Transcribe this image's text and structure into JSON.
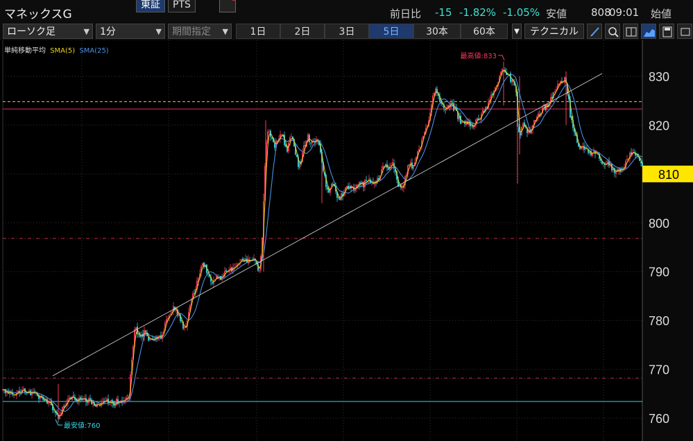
{
  "header": {
    "title": "マネックスG",
    "exchange_active": "東証",
    "exchange_other": "PTS",
    "prev_label": "前日比",
    "change": "-15",
    "change_pct": "-1.82%",
    "change_pct2": "-1.05%",
    "low_label": "安値",
    "low_value": "808",
    "time": "09:01",
    "open_label": "始値"
  },
  "toolbar": {
    "chart_type": "ローソク足",
    "interval": "1分",
    "period": "期間指定",
    "tabs": [
      "1日",
      "2日",
      "3日",
      "5日",
      "30本",
      "60本"
    ],
    "active_tab": "5日",
    "technical_label": "テクニカル"
  },
  "legend": {
    "title": "単純移動平均",
    "sma5": "SMA(5)",
    "sma25": "SMA(25)"
  },
  "colors": {
    "sma5": "#e8d21a",
    "sma25": "#4a90e2",
    "up": "#ff3a5a",
    "down": "#38d8e8",
    "price_box": "#ffe600"
  },
  "chart_data": {
    "type": "candlestick",
    "ylim": [
      757,
      840
    ],
    "y_ticks": [
      760,
      770,
      780,
      790,
      800,
      810,
      820,
      830
    ],
    "current_price": "810",
    "high_label": "最高値:833",
    "low_label": "最安値:760",
    "series": [
      {
        "name": "SMA(5)"
      },
      {
        "name": "SMA(25)"
      }
    ],
    "close_path": [
      [
        0,
        765.5
      ],
      [
        8,
        765.5
      ],
      [
        18,
        765.2
      ],
      [
        30,
        765.8
      ],
      [
        40,
        765.0
      ],
      [
        50,
        764.5
      ],
      [
        60,
        764.0
      ],
      [
        68,
        763.0
      ],
      [
        74,
        761.5
      ],
      [
        80,
        760.5
      ],
      [
        86,
        762.0
      ],
      [
        92,
        763.5
      ],
      [
        100,
        764.2
      ],
      [
        108,
        763.8
      ],
      [
        116,
        764.0
      ],
      [
        124,
        763.5
      ],
      [
        132,
        762.8
      ],
      [
        140,
        763.0
      ],
      [
        150,
        763.5
      ],
      [
        160,
        763.2
      ],
      [
        170,
        763.6
      ],
      [
        178,
        763.8
      ],
      [
        182,
        765.0
      ],
      [
        185,
        770.0
      ],
      [
        188,
        775.0
      ],
      [
        190,
        778.5
      ],
      [
        195,
        777.0
      ],
      [
        200,
        776.5
      ],
      [
        205,
        777.5
      ],
      [
        210,
        776.5
      ],
      [
        215,
        776.0
      ],
      [
        220,
        776.0
      ],
      [
        225,
        776.5
      ],
      [
        230,
        777.0
      ],
      [
        235,
        779.5
      ],
      [
        240,
        781.5
      ],
      [
        245,
        782.5
      ],
      [
        250,
        782.0
      ],
      [
        255,
        780.5
      ],
      [
        260,
        778.5
      ],
      [
        265,
        779.5
      ],
      [
        270,
        782.5
      ],
      [
        275,
        785.5
      ],
      [
        280,
        788.0
      ],
      [
        285,
        790.5
      ],
      [
        290,
        791.5
      ],
      [
        295,
        789.5
      ],
      [
        300,
        788.0
      ],
      [
        305,
        788.5
      ],
      [
        310,
        789.0
      ],
      [
        315,
        788.5
      ],
      [
        320,
        789.5
      ],
      [
        325,
        790.5
      ],
      [
        330,
        790.5
      ],
      [
        335,
        791.0
      ],
      [
        340,
        791.5
      ],
      [
        345,
        792.0
      ],
      [
        350,
        792.0
      ],
      [
        355,
        792.5
      ],
      [
        360,
        792.5
      ],
      [
        365,
        791.5
      ],
      [
        370,
        790.5
      ],
      [
        373,
        793.5
      ],
      [
        376,
        805.0
      ],
      [
        379,
        815.0
      ],
      [
        382,
        819.0
      ],
      [
        385,
        818.5
      ],
      [
        388,
        817.5
      ],
      [
        392,
        816.0
      ],
      [
        396,
        817.0
      ],
      [
        400,
        818.5
      ],
      [
        405,
        817.0
      ],
      [
        410,
        814.5
      ],
      [
        415,
        817.5
      ],
      [
        420,
        816.0
      ],
      [
        425,
        812.0
      ],
      [
        430,
        812.5
      ],
      [
        435,
        816.0
      ],
      [
        440,
        817.5
      ],
      [
        445,
        816.0
      ],
      [
        450,
        817.0
      ],
      [
        455,
        817.5
      ],
      [
        460,
        813.0
      ],
      [
        465,
        808.0
      ],
      [
        470,
        806.0
      ],
      [
        475,
        808.5
      ],
      [
        480,
        806.0
      ],
      [
        485,
        804.5
      ],
      [
        490,
        806.0
      ],
      [
        495,
        807.0
      ],
      [
        500,
        807.5
      ],
      [
        505,
        807.0
      ],
      [
        510,
        807.5
      ],
      [
        515,
        808.5
      ],
      [
        520,
        807.5
      ],
      [
        525,
        809.0
      ],
      [
        530,
        808.5
      ],
      [
        535,
        808.0
      ],
      [
        540,
        808.5
      ],
      [
        545,
        810.5
      ],
      [
        550,
        812.0
      ],
      [
        555,
        811.0
      ],
      [
        560,
        812.5
      ],
      [
        565,
        810.5
      ],
      [
        570,
        808.0
      ],
      [
        575,
        807.5
      ],
      [
        580,
        809.0
      ],
      [
        585,
        812.0
      ],
      [
        590,
        811.5
      ],
      [
        595,
        813.0
      ],
      [
        600,
        815.0
      ],
      [
        605,
        817.0
      ],
      [
        610,
        819.0
      ],
      [
        615,
        821.5
      ],
      [
        620,
        825.5
      ],
      [
        625,
        827.5
      ],
      [
        628,
        826.0
      ],
      [
        632,
        824.0
      ],
      [
        637,
        823.5
      ],
      [
        642,
        823.5
      ],
      [
        647,
        824.5
      ],
      [
        652,
        823.0
      ],
      [
        657,
        821.5
      ],
      [
        662,
        820.5
      ],
      [
        667,
        821.0
      ],
      [
        672,
        820.5
      ],
      [
        677,
        819.5
      ],
      [
        682,
        820.5
      ],
      [
        687,
        821.5
      ],
      [
        692,
        822.5
      ],
      [
        697,
        823.5
      ],
      [
        702,
        825.0
      ],
      [
        707,
        826.5
      ],
      [
        712,
        828.5
      ],
      [
        717,
        830.5
      ],
      [
        722,
        831.5
      ],
      [
        727,
        830.5
      ],
      [
        732,
        829.5
      ],
      [
        737,
        829.0
      ],
      [
        740,
        826.5
      ],
      [
        742,
        820.0
      ],
      [
        745,
        818.0
      ],
      [
        748,
        819.5
      ],
      [
        752,
        820.0
      ],
      [
        756,
        818.5
      ],
      [
        760,
        818.5
      ],
      [
        765,
        820.5
      ],
      [
        770,
        821.5
      ],
      [
        775,
        822.5
      ],
      [
        780,
        823.5
      ],
      [
        785,
        824.0
      ],
      [
        790,
        825.5
      ],
      [
        795,
        826.5
      ],
      [
        800,
        828.0
      ],
      [
        805,
        828.5
      ],
      [
        810,
        829.5
      ],
      [
        815,
        826.0
      ],
      [
        818,
        822.0
      ],
      [
        822,
        820.0
      ],
      [
        826,
        818.0
      ],
      [
        830,
        816.0
      ],
      [
        835,
        815.5
      ],
      [
        840,
        815.0
      ],
      [
        845,
        814.5
      ],
      [
        850,
        814.0
      ],
      [
        855,
        814.5
      ],
      [
        860,
        813.5
      ],
      [
        865,
        812.5
      ],
      [
        870,
        812.0
      ],
      [
        875,
        812.0
      ],
      [
        880,
        810.5
      ],
      [
        885,
        810.0
      ],
      [
        890,
        811.0
      ],
      [
        895,
        811.5
      ],
      [
        900,
        813.0
      ],
      [
        905,
        814.5
      ],
      [
        910,
        814.0
      ],
      [
        915,
        813.5
      ],
      [
        920,
        812.5
      ],
      [
        925,
        811.5
      ]
    ],
    "spikes": [
      [
        80,
        759.5,
        767
      ],
      [
        376,
        790,
        806
      ],
      [
        379,
        808,
        821
      ],
      [
        460,
        804,
        812
      ],
      [
        742,
        808,
        825
      ],
      [
        745,
        814,
        830
      ],
      [
        722,
        824,
        833
      ],
      [
        812,
        820,
        831
      ]
    ]
  }
}
